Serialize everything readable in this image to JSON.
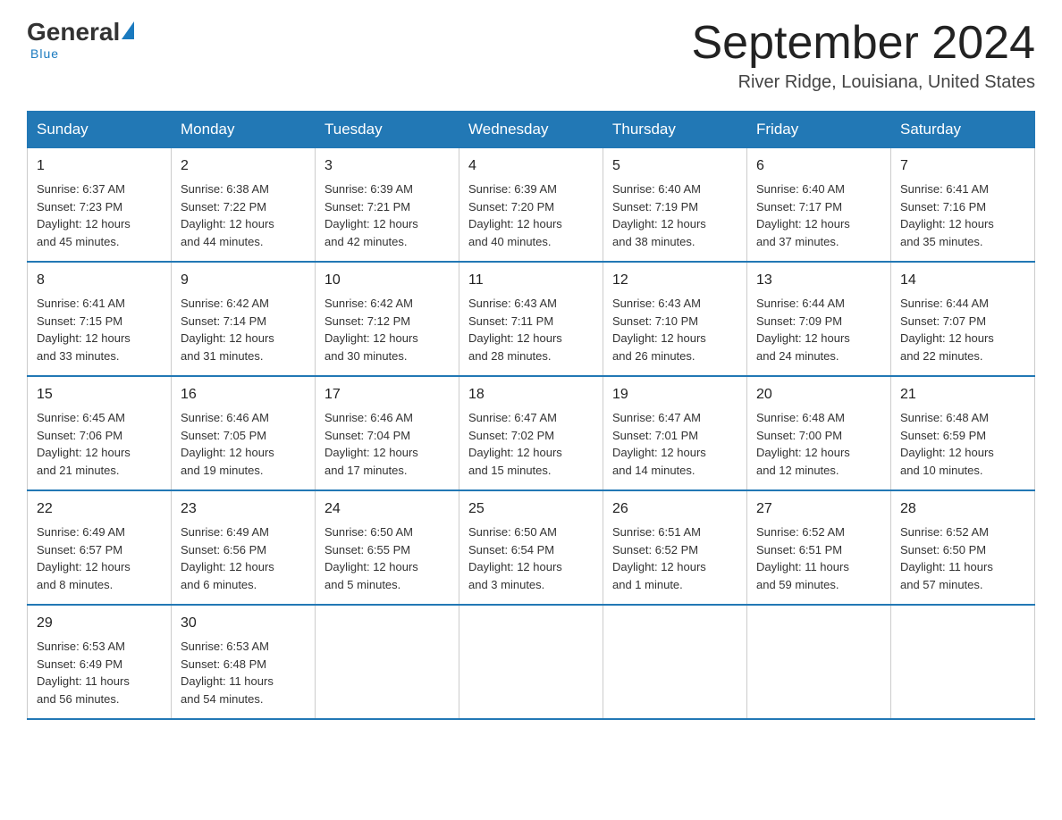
{
  "header": {
    "logo_general": "General",
    "logo_blue": "Blue",
    "month_title": "September 2024",
    "location": "River Ridge, Louisiana, United States"
  },
  "days_of_week": [
    "Sunday",
    "Monday",
    "Tuesday",
    "Wednesday",
    "Thursday",
    "Friday",
    "Saturday"
  ],
  "weeks": [
    [
      {
        "day": "1",
        "sunrise": "6:37 AM",
        "sunset": "7:23 PM",
        "daylight": "12 hours and 45 minutes."
      },
      {
        "day": "2",
        "sunrise": "6:38 AM",
        "sunset": "7:22 PM",
        "daylight": "12 hours and 44 minutes."
      },
      {
        "day": "3",
        "sunrise": "6:39 AM",
        "sunset": "7:21 PM",
        "daylight": "12 hours and 42 minutes."
      },
      {
        "day": "4",
        "sunrise": "6:39 AM",
        "sunset": "7:20 PM",
        "daylight": "12 hours and 40 minutes."
      },
      {
        "day": "5",
        "sunrise": "6:40 AM",
        "sunset": "7:19 PM",
        "daylight": "12 hours and 38 minutes."
      },
      {
        "day": "6",
        "sunrise": "6:40 AM",
        "sunset": "7:17 PM",
        "daylight": "12 hours and 37 minutes."
      },
      {
        "day": "7",
        "sunrise": "6:41 AM",
        "sunset": "7:16 PM",
        "daylight": "12 hours and 35 minutes."
      }
    ],
    [
      {
        "day": "8",
        "sunrise": "6:41 AM",
        "sunset": "7:15 PM",
        "daylight": "12 hours and 33 minutes."
      },
      {
        "day": "9",
        "sunrise": "6:42 AM",
        "sunset": "7:14 PM",
        "daylight": "12 hours and 31 minutes."
      },
      {
        "day": "10",
        "sunrise": "6:42 AM",
        "sunset": "7:12 PM",
        "daylight": "12 hours and 30 minutes."
      },
      {
        "day": "11",
        "sunrise": "6:43 AM",
        "sunset": "7:11 PM",
        "daylight": "12 hours and 28 minutes."
      },
      {
        "day": "12",
        "sunrise": "6:43 AM",
        "sunset": "7:10 PM",
        "daylight": "12 hours and 26 minutes."
      },
      {
        "day": "13",
        "sunrise": "6:44 AM",
        "sunset": "7:09 PM",
        "daylight": "12 hours and 24 minutes."
      },
      {
        "day": "14",
        "sunrise": "6:44 AM",
        "sunset": "7:07 PM",
        "daylight": "12 hours and 22 minutes."
      }
    ],
    [
      {
        "day": "15",
        "sunrise": "6:45 AM",
        "sunset": "7:06 PM",
        "daylight": "12 hours and 21 minutes."
      },
      {
        "day": "16",
        "sunrise": "6:46 AM",
        "sunset": "7:05 PM",
        "daylight": "12 hours and 19 minutes."
      },
      {
        "day": "17",
        "sunrise": "6:46 AM",
        "sunset": "7:04 PM",
        "daylight": "12 hours and 17 minutes."
      },
      {
        "day": "18",
        "sunrise": "6:47 AM",
        "sunset": "7:02 PM",
        "daylight": "12 hours and 15 minutes."
      },
      {
        "day": "19",
        "sunrise": "6:47 AM",
        "sunset": "7:01 PM",
        "daylight": "12 hours and 14 minutes."
      },
      {
        "day": "20",
        "sunrise": "6:48 AM",
        "sunset": "7:00 PM",
        "daylight": "12 hours and 12 minutes."
      },
      {
        "day": "21",
        "sunrise": "6:48 AM",
        "sunset": "6:59 PM",
        "daylight": "12 hours and 10 minutes."
      }
    ],
    [
      {
        "day": "22",
        "sunrise": "6:49 AM",
        "sunset": "6:57 PM",
        "daylight": "12 hours and 8 minutes."
      },
      {
        "day": "23",
        "sunrise": "6:49 AM",
        "sunset": "6:56 PM",
        "daylight": "12 hours and 6 minutes."
      },
      {
        "day": "24",
        "sunrise": "6:50 AM",
        "sunset": "6:55 PM",
        "daylight": "12 hours and 5 minutes."
      },
      {
        "day": "25",
        "sunrise": "6:50 AM",
        "sunset": "6:54 PM",
        "daylight": "12 hours and 3 minutes."
      },
      {
        "day": "26",
        "sunrise": "6:51 AM",
        "sunset": "6:52 PM",
        "daylight": "12 hours and 1 minute."
      },
      {
        "day": "27",
        "sunrise": "6:52 AM",
        "sunset": "6:51 PM",
        "daylight": "11 hours and 59 minutes."
      },
      {
        "day": "28",
        "sunrise": "6:52 AM",
        "sunset": "6:50 PM",
        "daylight": "11 hours and 57 minutes."
      }
    ],
    [
      {
        "day": "29",
        "sunrise": "6:53 AM",
        "sunset": "6:49 PM",
        "daylight": "11 hours and 56 minutes."
      },
      {
        "day": "30",
        "sunrise": "6:53 AM",
        "sunset": "6:48 PM",
        "daylight": "11 hours and 54 minutes."
      },
      null,
      null,
      null,
      null,
      null
    ]
  ],
  "labels": {
    "sunrise": "Sunrise:",
    "sunset": "Sunset:",
    "daylight": "Daylight:"
  }
}
